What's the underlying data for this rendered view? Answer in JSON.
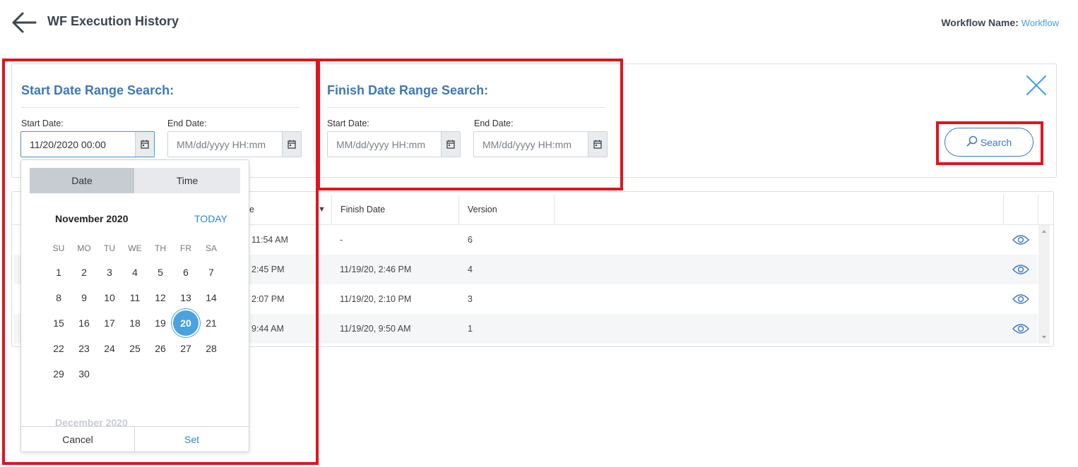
{
  "header": {
    "title": "WF Execution History",
    "workflow_name_label": "Workflow Name:",
    "workflow_name_value": "Workflow"
  },
  "start_range": {
    "title": "Start Date Range Search:",
    "start_label": "Start Date:",
    "start_value": "11/20/2020 00:00",
    "end_label": "End Date:",
    "end_placeholder": "MM/dd/yyyy HH:mm"
  },
  "finish_range": {
    "title": "Finish Date Range Search:",
    "start_label": "Start Date:",
    "start_placeholder": "MM/dd/yyyy HH:mm",
    "end_label": "End Date:",
    "end_placeholder": "MM/dd/yyyy HH:mm"
  },
  "search_button": "Search",
  "table": {
    "columns": [
      "e",
      "Finish Date",
      "Version"
    ],
    "sort_indicator": "▼",
    "rows": [
      {
        "start": "11:54 AM",
        "finish": "-",
        "version": "6"
      },
      {
        "start": "2:45 PM",
        "finish": "11/19/20, 2:46 PM",
        "version": "4"
      },
      {
        "start": "2:07 PM",
        "finish": "11/19/20, 2:10 PM",
        "version": "3"
      },
      {
        "start": "9:44 AM",
        "finish": "11/19/20, 9:50 AM",
        "version": "1"
      }
    ]
  },
  "picker": {
    "tab_date": "Date",
    "tab_time": "Time",
    "month": "November 2020",
    "today": "TODAY",
    "weekdays": [
      "SU",
      "MO",
      "TU",
      "WE",
      "TH",
      "FR",
      "SA"
    ],
    "weeks": [
      [
        "1",
        "2",
        "3",
        "4",
        "5",
        "6",
        "7"
      ],
      [
        "8",
        "9",
        "10",
        "11",
        "12",
        "13",
        "14"
      ],
      [
        "15",
        "16",
        "17",
        "18",
        "19",
        "20",
        "21"
      ],
      [
        "22",
        "23",
        "24",
        "25",
        "26",
        "27",
        "28"
      ],
      [
        "29",
        "30"
      ]
    ],
    "selected_day": "20",
    "next_month": "December 2020",
    "cancel": "Cancel",
    "set": "Set"
  },
  "colors": {
    "accent": "#3f78b8",
    "link": "#4a9ed6",
    "selected_day": "#4aa3df",
    "annotation_red": "#e0141e"
  }
}
